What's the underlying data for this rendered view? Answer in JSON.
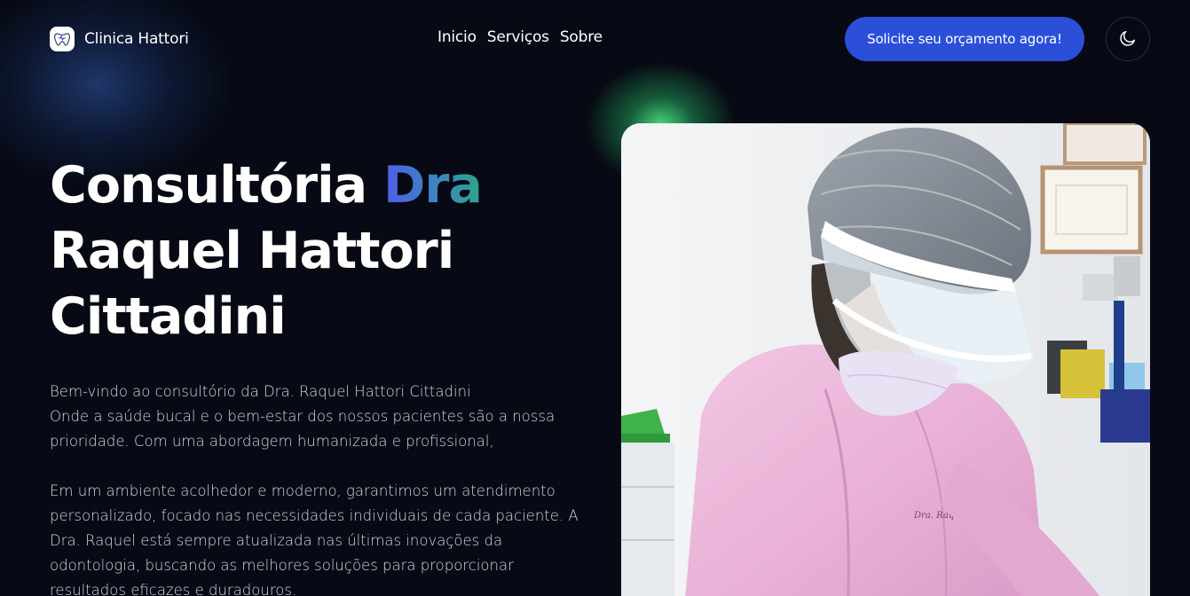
{
  "header": {
    "brand": "Clinica Hattori",
    "logo_icon": "tooth-heart-icon",
    "nav": [
      "Inicio",
      "Serviços",
      "Sobre"
    ],
    "cta_label": "Solicite seu orçamento agora!",
    "theme_icon": "moon-icon"
  },
  "hero": {
    "title_part1": "Consultória ",
    "title_accent": "Dra",
    "title_part2": "Raquel Hattori",
    "title_part3": "Cittadini",
    "paragraph1_line1": "Bem-vindo ao consultório da Dra. Raquel Hattori Cittadini",
    "paragraph1_line2": "Onde a saúde bucal e o bem-estar dos nossos pacientes são a nossa prioridade. Com uma abordagem humanizada e profissional,",
    "paragraph2": "Em um ambiente acolhedor e moderno, garantimos um atendimento personalizado, focado nas necessidades individuais de cada paciente. A Dra. Raquel está sempre atualizada nas últimas inovações da odontologia, buscando as melhores soluções para proporcionar resultados eficazes e duradouros.",
    "photo_embroidery": "Dra. Raquel"
  },
  "colors": {
    "background": "#070a14",
    "cta": "#2b4fd9",
    "accent_gradient_start": "#4f5ee8",
    "accent_gradient_end": "#2fa48a",
    "glow_green": "#4ade80"
  }
}
